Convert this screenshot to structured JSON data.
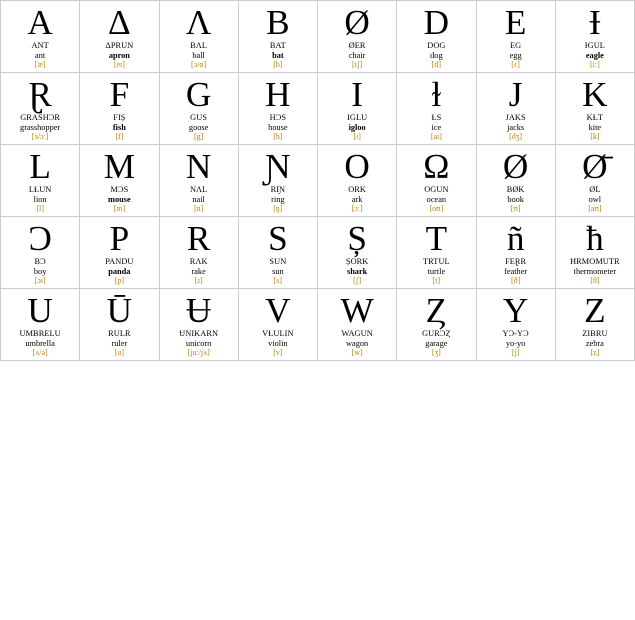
{
  "cells": [
    {
      "big": "A",
      "upper": "ANT",
      "lower": "ant",
      "lower_bold": false,
      "phonetic": "[æ]"
    },
    {
      "big": "Δ",
      "upper": "ΔPRUN",
      "lower": "apron",
      "lower_bold": true,
      "phonetic": "[eɪ]"
    },
    {
      "big": "Λ",
      "upper": "BΛL",
      "lower": "ball",
      "lower_bold": false,
      "phonetic": "[ɔ/ɑ]"
    },
    {
      "big": "B",
      "upper": "BAT",
      "lower": "bat",
      "lower_bold": true,
      "phonetic": "[b]"
    },
    {
      "big": "Ø",
      "upper": "ØER",
      "lower": "chair",
      "lower_bold": false,
      "phonetic": "[tʃ]"
    },
    {
      "big": "D",
      "upper": "DOG",
      "lower": "dog",
      "lower_bold": false,
      "phonetic": "[d]"
    },
    {
      "big": "E",
      "upper": "EG",
      "lower": "egg",
      "lower_bold": false,
      "phonetic": "[ɛ]"
    },
    {
      "big": "Ɨ",
      "upper": "ƗGUL",
      "lower": "eagle",
      "lower_bold": true,
      "phonetic": "[iː]"
    },
    {
      "big": "Ɽ",
      "upper": "GRASHƆR",
      "lower": "grasshopper",
      "lower_bold": false,
      "phonetic": "[ɜ/ɔː]"
    },
    {
      "big": "F",
      "upper": "FIȘ",
      "lower": "fish",
      "lower_bold": true,
      "phonetic": "[f]"
    },
    {
      "big": "G",
      "upper": "GUS",
      "lower": "goose",
      "lower_bold": false,
      "phonetic": "[g]"
    },
    {
      "big": "H",
      "upper": "HƆS",
      "lower": "house",
      "lower_bold": false,
      "phonetic": "[h]"
    },
    {
      "big": "I",
      "upper": "IGLU",
      "lower": "igloo",
      "lower_bold": true,
      "phonetic": "[ɪ]"
    },
    {
      "big": "ɫ",
      "upper": "ɫS",
      "lower": "ice",
      "lower_bold": false,
      "phonetic": "[aɪ]"
    },
    {
      "big": "J",
      "upper": "JAKS",
      "lower": "jacks",
      "lower_bold": false,
      "phonetic": "[dʒ]"
    },
    {
      "big": "K",
      "upper": "KɫT",
      "lower": "kite",
      "lower_bold": false,
      "phonetic": "[k]"
    },
    {
      "big": "L",
      "upper": "LɫUN",
      "lower": "lion",
      "lower_bold": false,
      "phonetic": "[l]"
    },
    {
      "big": "M",
      "upper": "MƆS",
      "lower": "mouse",
      "lower_bold": true,
      "phonetic": "[m]"
    },
    {
      "big": "N",
      "upper": "NΛL",
      "lower": "nail",
      "lower_bold": false,
      "phonetic": "[n]"
    },
    {
      "big": "Ɲ",
      "upper": "RIɲ",
      "lower": "ring",
      "lower_bold": false,
      "phonetic": "[ŋ]"
    },
    {
      "big": "O",
      "upper": "ORK",
      "lower": "ark",
      "lower_bold": false,
      "phonetic": "[ɔː]"
    },
    {
      "big": "Ω",
      "upper": "OGUN",
      "lower": "ocean",
      "lower_bold": false,
      "phonetic": "[oʊ]"
    },
    {
      "big": "Ø",
      "upper": "BØK",
      "lower": "book",
      "lower_bold": false,
      "phonetic": "[ʊ]"
    },
    {
      "big": "Ø̄",
      "upper": "ØL",
      "lower": "owl",
      "lower_bold": false,
      "phonetic": "[aʊ]"
    },
    {
      "big": "Ɔ",
      "upper": "BƆ",
      "lower": "boy",
      "lower_bold": false,
      "phonetic": "[ɔɪ]"
    },
    {
      "big": "P",
      "upper": "PANDU",
      "lower": "panda",
      "lower_bold": true,
      "phonetic": "[p]"
    },
    {
      "big": "R",
      "upper": "RΛK",
      "lower": "rake",
      "lower_bold": false,
      "phonetic": "[ɹ]"
    },
    {
      "big": "S",
      "upper": "SUN",
      "lower": "sun",
      "lower_bold": false,
      "phonetic": "[s]"
    },
    {
      "big": "Ș",
      "upper": "ȘORK",
      "lower": "shark",
      "lower_bold": true,
      "phonetic": "[ʃ]"
    },
    {
      "big": "T",
      "upper": "TRTUL",
      "lower": "turtle",
      "lower_bold": false,
      "phonetic": "[t]"
    },
    {
      "big": "ñ",
      "upper": "FEⱤR",
      "lower": "feather",
      "lower_bold": false,
      "phonetic": "[ð]"
    },
    {
      "big": "ħ",
      "upper": "ħRMOMUTR",
      "lower": "thermometer",
      "lower_bold": false,
      "phonetic": "[θ]"
    },
    {
      "big": "U",
      "upper": "UMBRELU",
      "lower": "umbrella",
      "lower_bold": false,
      "phonetic": "[ʌ/ə]"
    },
    {
      "big": "Ū",
      "upper": "RULR",
      "lower": "ruler",
      "lower_bold": false,
      "phonetic": "[u]"
    },
    {
      "big": "Ʉ",
      "upper": "ɄNIKARN",
      "lower": "unicorn",
      "lower_bold": false,
      "phonetic": "[juː/jʌ]"
    },
    {
      "big": "V",
      "upper": "VɫULIN",
      "lower": "violin",
      "lower_bold": false,
      "phonetic": "[v]"
    },
    {
      "big": "W",
      "upper": "WAGUN",
      "lower": "wagon",
      "lower_bold": false,
      "phonetic": "[w]"
    },
    {
      "big": "Ȥ",
      "upper": "GURƆȤ",
      "lower": "garage",
      "lower_bold": false,
      "phonetic": "[ʒ]"
    },
    {
      "big": "Y",
      "upper": "YƆ-YƆ",
      "lower": "yo-yo",
      "lower_bold": false,
      "phonetic": "[j]"
    },
    {
      "big": "Z",
      "upper": "ZIBRU",
      "lower": "zebra",
      "lower_bold": false,
      "phonetic": "[z]"
    }
  ]
}
